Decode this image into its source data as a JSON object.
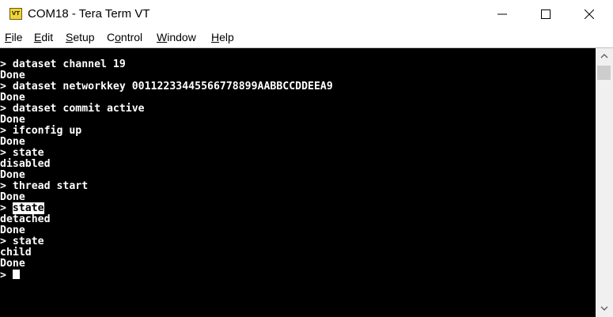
{
  "window": {
    "title": "COM18 - Tera Term VT",
    "icon": "tera-term-app-icon",
    "icon_label": "VT",
    "controls": [
      "minimize-icon",
      "maximize-icon",
      "close-icon"
    ]
  },
  "menu": {
    "items": [
      {
        "key": "F",
        "rest": "ile"
      },
      {
        "key": "E",
        "rest": "dit"
      },
      {
        "key": "S",
        "rest": "etup"
      },
      {
        "key": "",
        "pre": "C",
        "key2": "o",
        "rest": "ntrol"
      },
      {
        "key": "W",
        "rest": "indow"
      },
      {
        "key": "H",
        "rest": "elp"
      }
    ]
  },
  "terminal": {
    "lines": [
      "> dataset channel 19",
      "Done",
      "> dataset networkkey 00112233445566778899AABBCCDDEEA9",
      "Done",
      "> dataset commit active",
      "Done",
      "> ifconfig up",
      "Done",
      "> state",
      "disabled",
      "Done",
      "> thread start",
      "Done"
    ],
    "highlight_prompt": "> ",
    "highlight_cmd": "state",
    "lines_after": [
      "detached",
      "Done",
      "> state",
      "child",
      "Done"
    ],
    "final_prompt": "> "
  },
  "colors": {
    "terminal_bg": "#000000",
    "terminal_fg": "#ffffff",
    "scrollbar_bg": "#f0f0f0",
    "scrollbar_thumb": "#cdcdcd"
  }
}
